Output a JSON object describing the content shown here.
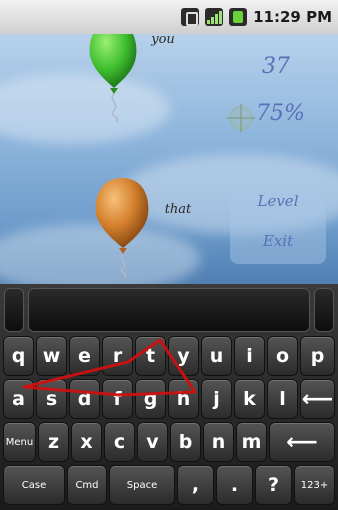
{
  "status_bar": {
    "time": "11:29 PM",
    "icons": [
      "notification-icon",
      "signal-icon",
      "battery-icon"
    ]
  },
  "game": {
    "score": "37",
    "accuracy": "75%",
    "menu": {
      "level_label": "Level",
      "exit_label": "Exit"
    },
    "balloons": [
      {
        "word": "you",
        "color": "#3fbf2f"
      },
      {
        "word": "that",
        "color": "#d4812e"
      }
    ]
  },
  "keyboard": {
    "row1": [
      "q",
      "w",
      "e",
      "r",
      "t",
      "y",
      "u",
      "i",
      "o",
      "p"
    ],
    "row2": [
      "a",
      "s",
      "d",
      "f",
      "g",
      "h",
      "j",
      "k",
      "l"
    ],
    "row3": [
      "z",
      "x",
      "c",
      "v",
      "b",
      "n",
      "m"
    ],
    "row4": {
      "case": "Case",
      "cmd": "Cmd",
      "space": "Space",
      "comma": ",",
      "period": ".",
      "question": "?",
      "numbers": "123+"
    },
    "menu": "Menu",
    "backspace": "⟵",
    "enter": "⟵",
    "gesture_color": "#cc1111"
  }
}
